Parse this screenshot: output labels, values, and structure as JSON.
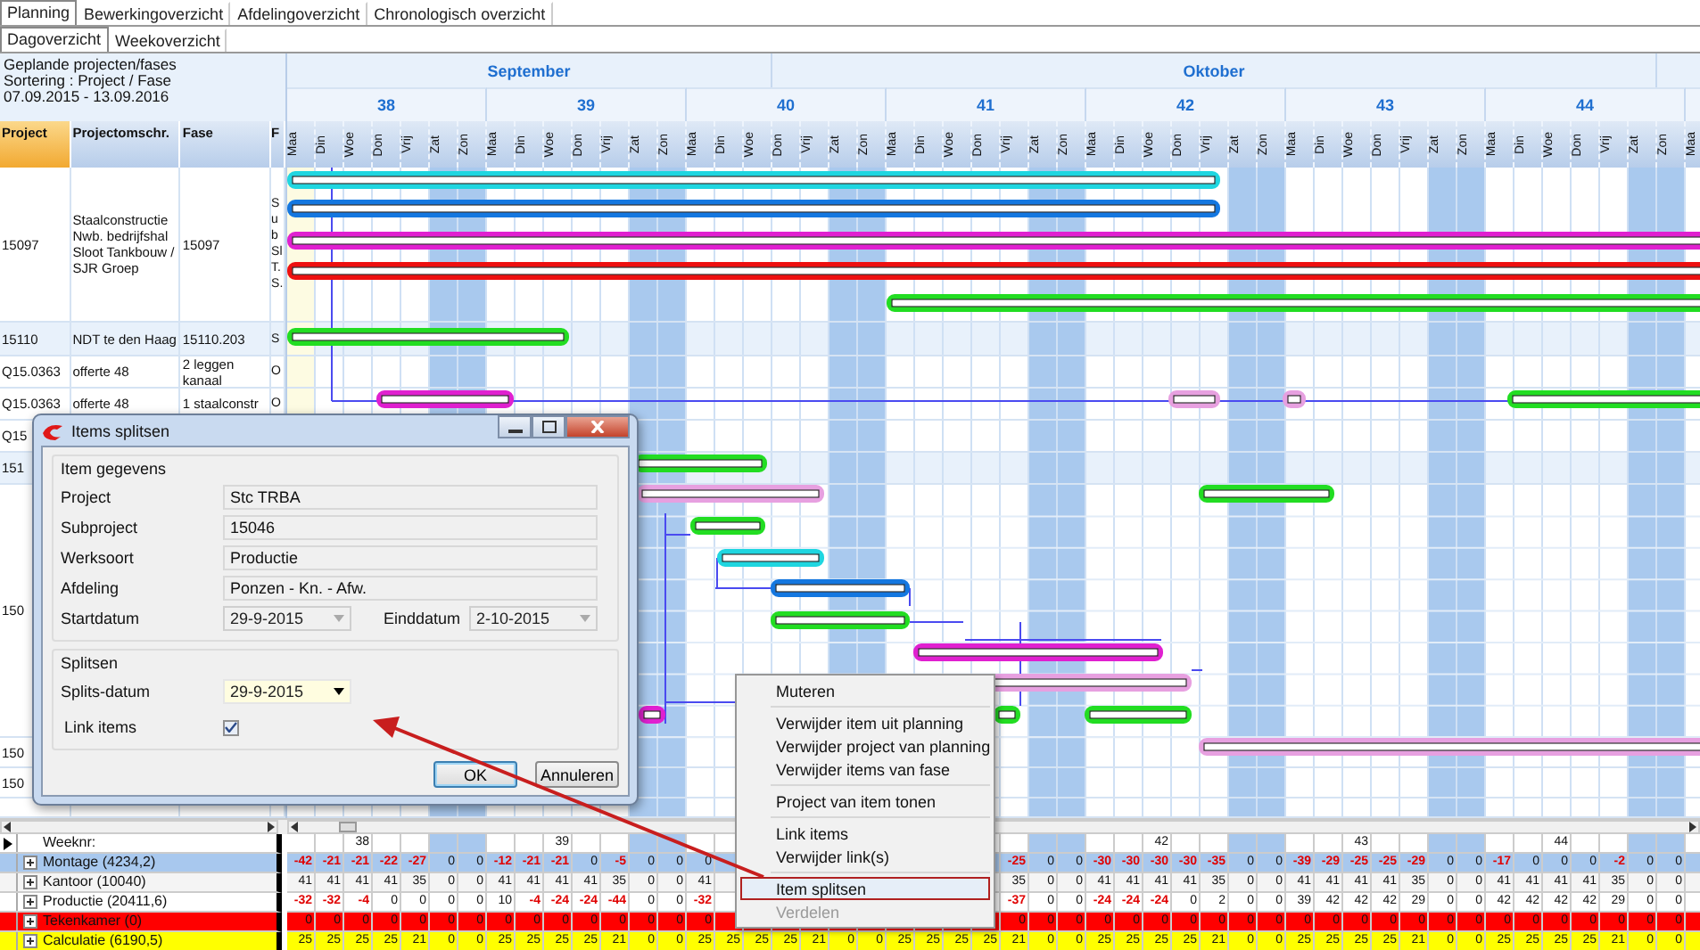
{
  "tabs": [
    {
      "label": "Planning",
      "selected": true
    },
    {
      "label": "Bewerkingoverzicht",
      "selected": false
    },
    {
      "label": "Afdelingoverzicht",
      "selected": false
    },
    {
      "label": "Chronologisch overzicht",
      "selected": false
    }
  ],
  "subtabs": [
    {
      "label": "Dagoverzicht",
      "selected": true
    },
    {
      "label": "Weekoverzicht",
      "selected": false
    }
  ],
  "info": [
    "Geplande projecten/fases",
    "Sortering : Project / Fase",
    "07.09.2015 - 13.09.2016"
  ],
  "grid": {
    "columns": [
      "Project",
      "Projectomschr.",
      "Fase",
      "F"
    ],
    "rows": [
      {
        "project": "15097",
        "description": "Staalconstructie Nwb. bedrijfshal Sloot Tankbouw / SJR Groep",
        "phase": "15097",
        "column_4": [
          "S",
          "u",
          "b",
          "Sl",
          "T.",
          "S."
        ],
        "highlighted": false
      },
      {
        "project": "15110",
        "description": "NDT te den Haag",
        "phase": "15110.203",
        "column_4": [
          "S"
        ],
        "highlighted": true
      },
      {
        "project": "Q15.0363",
        "description": "offerte 48",
        "phase": "2 leggen kanaal",
        "column_4": [
          "O"
        ],
        "highlighted": false
      },
      {
        "project": "Q15.0363",
        "description": "offerte 48",
        "phase": "1 staalconstr",
        "column_4": [
          "O"
        ],
        "highlighted": false
      },
      {
        "project": "Q15",
        "highlighted": false
      },
      {
        "project": "151",
        "highlighted": true
      },
      {
        "project": "150",
        "highlighted": false
      },
      {
        "project": "150",
        "highlighted": false
      },
      {
        "project": "150",
        "highlighted": false
      }
    ]
  },
  "timeline": {
    "months": [
      {
        "label": "September"
      },
      {
        "label": "Oktober"
      }
    ],
    "weeks": [
      "38",
      "39",
      "40",
      "41",
      "42",
      "43",
      "44"
    ],
    "days": [
      {
        "label": "Maa",
        "weekend": false,
        "totals": [
          "-42",
          "41",
          "-32",
          "0",
          "25"
        ]
      },
      {
        "label": "Din",
        "weekend": false,
        "totals": [
          "-21",
          "41",
          "-32",
          "0",
          "25"
        ]
      },
      {
        "label": "Woe",
        "weekend": false,
        "week_number": "38",
        "totals": [
          "-21",
          "41",
          "-4",
          "0",
          "25"
        ]
      },
      {
        "label": "Don",
        "weekend": false,
        "totals": [
          "-22",
          "41",
          "0",
          "0",
          "25"
        ]
      },
      {
        "label": "Vrij",
        "weekend": false,
        "totals": [
          "-27",
          "35",
          "0",
          "0",
          "21"
        ]
      },
      {
        "label": "Zat",
        "weekend": true,
        "totals": [
          "0",
          "0",
          "0",
          "0",
          "0"
        ]
      },
      {
        "label": "Zon",
        "weekend": true,
        "totals": [
          "0",
          "0",
          "0",
          "0",
          "0"
        ]
      },
      {
        "label": "Maa",
        "weekend": false,
        "totals": [
          "-12",
          "41",
          "10",
          "0",
          "25"
        ]
      },
      {
        "label": "Din",
        "weekend": false,
        "totals": [
          "-21",
          "41",
          "-4",
          "0",
          "25"
        ]
      },
      {
        "label": "Woe",
        "weekend": false,
        "week_number": "39",
        "totals": [
          "-21",
          "41",
          "-24",
          "0",
          "25"
        ]
      },
      {
        "label": "Don",
        "weekend": false,
        "totals": [
          "0",
          "41",
          "-24",
          "0",
          "25"
        ]
      },
      {
        "label": "Vrij",
        "weekend": false,
        "totals": [
          "-5",
          "35",
          "-44",
          "0",
          "21"
        ]
      },
      {
        "label": "Zat",
        "weekend": true,
        "totals": [
          "0",
          "0",
          "0",
          "0",
          "0"
        ]
      },
      {
        "label": "Zon",
        "weekend": true,
        "totals": [
          "0",
          "0",
          "0",
          "0",
          "0"
        ]
      },
      {
        "label": "Maa",
        "weekend": false,
        "totals": [
          "0",
          "41",
          "-32",
          "0",
          "25"
        ]
      },
      {
        "label": "Din",
        "weekend": false,
        "last_row_total": "25"
      },
      {
        "label": "Woe",
        "weekend": false,
        "last_row_total": "25"
      },
      {
        "label": "Don",
        "weekend": false,
        "last_row_total": "25"
      },
      {
        "label": "Vrij",
        "weekend": false,
        "last_row_total": "21"
      },
      {
        "label": "Zat",
        "weekend": true,
        "last_row_total": "0"
      },
      {
        "label": "Zon",
        "weekend": true,
        "last_row_total": "0"
      },
      {
        "label": "Maa",
        "weekend": false,
        "last_row_total": "25"
      },
      {
        "label": "Din",
        "weekend": false,
        "last_row_total": "25"
      },
      {
        "label": "Woe",
        "weekend": false,
        "last_row_total": "25"
      },
      {
        "label": "Don",
        "weekend": false,
        "last_row_total": "25"
      },
      {
        "label": "Vrij",
        "weekend": false,
        "totals": [
          "-25",
          "35",
          "-37",
          "0",
          "21"
        ]
      },
      {
        "label": "Zat",
        "weekend": true,
        "totals": [
          "0",
          "0",
          "0",
          "0",
          "0"
        ]
      },
      {
        "label": "Zon",
        "weekend": true,
        "totals": [
          "0",
          "0",
          "0",
          "0",
          "0"
        ]
      },
      {
        "label": "Maa",
        "weekend": false,
        "totals": [
          "-30",
          "41",
          "-24",
          "0",
          "25"
        ]
      },
      {
        "label": "Din",
        "weekend": false,
        "totals": [
          "-30",
          "41",
          "-24",
          "0",
          "25"
        ]
      },
      {
        "label": "Woe",
        "weekend": false,
        "week_number": "42",
        "totals": [
          "-30",
          "41",
          "-24",
          "0",
          "25"
        ]
      },
      {
        "label": "Don",
        "weekend": false,
        "totals": [
          "-30",
          "41",
          "0",
          "0",
          "25"
        ]
      },
      {
        "label": "Vrij",
        "weekend": false,
        "totals": [
          "-35",
          "35",
          "2",
          "0",
          "21"
        ]
      },
      {
        "label": "Zat",
        "weekend": true,
        "totals": [
          "0",
          "0",
          "0",
          "0",
          "0"
        ]
      },
      {
        "label": "Zon",
        "weekend": true,
        "totals": [
          "0",
          "0",
          "0",
          "0",
          "0"
        ]
      },
      {
        "label": "Maa",
        "weekend": false,
        "totals": [
          "-39",
          "41",
          "39",
          "0",
          "25"
        ]
      },
      {
        "label": "Din",
        "weekend": false,
        "totals": [
          "-29",
          "41",
          "42",
          "0",
          "25"
        ]
      },
      {
        "label": "Woe",
        "weekend": false,
        "week_number": "43",
        "totals": [
          "-25",
          "41",
          "42",
          "0",
          "25"
        ]
      },
      {
        "label": "Don",
        "weekend": false,
        "totals": [
          "-25",
          "41",
          "42",
          "0",
          "25"
        ]
      },
      {
        "label": "Vrij",
        "weekend": false,
        "totals": [
          "-29",
          "35",
          "29",
          "0",
          "21"
        ]
      },
      {
        "label": "Zat",
        "weekend": true,
        "totals": [
          "0",
          "0",
          "0",
          "0",
          "0"
        ]
      },
      {
        "label": "Zon",
        "weekend": true,
        "totals": [
          "0",
          "0",
          "0",
          "0",
          "0"
        ]
      },
      {
        "label": "Maa",
        "weekend": false,
        "totals": [
          "-17",
          "41",
          "42",
          "0",
          "25"
        ]
      },
      {
        "label": "Din",
        "weekend": false,
        "totals": [
          "0",
          "41",
          "42",
          "0",
          "25"
        ]
      },
      {
        "label": "Woe",
        "weekend": false,
        "week_number": "44",
        "totals": [
          "0",
          "41",
          "42",
          "0",
          "25"
        ]
      },
      {
        "label": "Don",
        "weekend": false,
        "totals": [
          "0",
          "41",
          "42",
          "0",
          "25"
        ]
      },
      {
        "label": "Vrij",
        "weekend": false,
        "totals": [
          "-2",
          "35",
          "29",
          "0",
          "21"
        ]
      },
      {
        "label": "Zat",
        "weekend": true,
        "totals": [
          "0",
          "0",
          "0",
          "0",
          "0"
        ]
      },
      {
        "label": "Zon",
        "weekend": true,
        "totals": [
          "0",
          "0",
          "0",
          "0",
          "0"
        ]
      },
      {
        "label": "Maa",
        "weekend": false
      }
    ]
  },
  "summary": {
    "header": {
      "label": "Weeknr:"
    },
    "rows": [
      {
        "label": "Montage (4234,2)",
        "color": "#a8c8ee"
      },
      {
        "label": "Kantoor (10040)",
        "color": "#f4f4f4"
      },
      {
        "label": "Productie (20411,6)",
        "color": "#ffffff"
      },
      {
        "label": "Tekenkamer (0)",
        "color": "#ff0000"
      },
      {
        "label": "Calculatie (6190,5)",
        "color": "#ffff00"
      }
    ]
  },
  "dialog": {
    "title": "Items splitsen",
    "sections": [
      {
        "title": "Item gegevens",
        "fields": [
          {
            "label": "Project",
            "value": "Stc TRBA",
            "kind": "text"
          },
          {
            "label": "Subproject",
            "value": "15046",
            "kind": "text"
          },
          {
            "label": "Werksoort",
            "value": "Productie",
            "kind": "text"
          },
          {
            "label": "Afdeling",
            "value": "Ponzen - Kn. - Afw.",
            "kind": "text"
          },
          {
            "label": "Startdatum",
            "value": "29-9-2015",
            "kind": "date",
            "disabled": true
          },
          {
            "label": "Einddatum",
            "value": "2-10-2015",
            "kind": "date",
            "disabled": true
          }
        ]
      },
      {
        "title": "Splitsen",
        "fields": [
          {
            "label": "Splits-datum",
            "value": "29-9-2015",
            "kind": "date",
            "disabled": false
          },
          {
            "label": "Link items",
            "kind": "checkbox",
            "checked": true
          }
        ]
      }
    ],
    "buttons": [
      {
        "label": "OK",
        "focused": true
      },
      {
        "label": "Annuleren",
        "focused": false
      }
    ]
  },
  "context_menu": {
    "items": [
      {
        "kind": "item",
        "label": "Muteren",
        "selected": false,
        "disabled": false
      },
      {
        "kind": "separator"
      },
      {
        "kind": "item",
        "label": "Verwijder item uit planning",
        "selected": false,
        "disabled": false
      },
      {
        "kind": "item",
        "label": "Verwijder project van planning",
        "selected": false,
        "disabled": false
      },
      {
        "kind": "item",
        "label": "Verwijder items van fase",
        "selected": false,
        "disabled": false
      },
      {
        "kind": "separator"
      },
      {
        "kind": "item",
        "label": "Project van item tonen",
        "selected": false,
        "disabled": false
      },
      {
        "kind": "separator"
      },
      {
        "kind": "item",
        "label": "Link items",
        "selected": false,
        "disabled": false
      },
      {
        "kind": "item",
        "label": "Verwijder link(s)",
        "selected": false,
        "disabled": false
      },
      {
        "kind": "separator"
      },
      {
        "kind": "item",
        "label": "Item splitsen",
        "selected": true,
        "disabled": false
      },
      {
        "kind": "item",
        "label": "Verdelen",
        "selected": false,
        "disabled": true
      }
    ]
  }
}
